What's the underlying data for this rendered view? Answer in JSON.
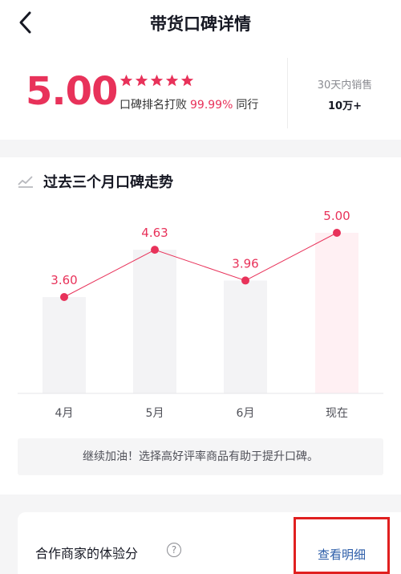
{
  "header": {
    "title": "带货口碑详情",
    "back_icon": "chevron-left-icon"
  },
  "summary": {
    "score": "5.00",
    "stars": 5,
    "rank_prefix": "口碑排名打败",
    "rank_percent": "99.99%",
    "rank_suffix": "同行",
    "sales_label": "30天内销售",
    "sales_value": "10万+"
  },
  "trend": {
    "title": "过去三个月口碑走势",
    "icon": "trend-line-icon",
    "tip": "继续加油！选择高好评率商品有助于提升口碑。"
  },
  "chart_data": {
    "type": "bar",
    "categories": [
      "4月",
      "5月",
      "6月",
      "现在"
    ],
    "values": [
      3.6,
      4.63,
      3.96,
      5.0
    ],
    "labels": [
      "3.60",
      "4.63",
      "3.96",
      "5.00"
    ],
    "ylim": [
      0,
      5
    ],
    "line_overlay": true,
    "highlight_last": true
  },
  "partner": {
    "title": "合作商家的体验分",
    "help": "?",
    "detail_link": "查看明细"
  },
  "colors": {
    "accent": "#e8325a",
    "bar": "#f3f3f5",
    "bar_highlight": "#fff0f3",
    "link": "#2b5ca8",
    "highlight_box": "#e02020"
  }
}
